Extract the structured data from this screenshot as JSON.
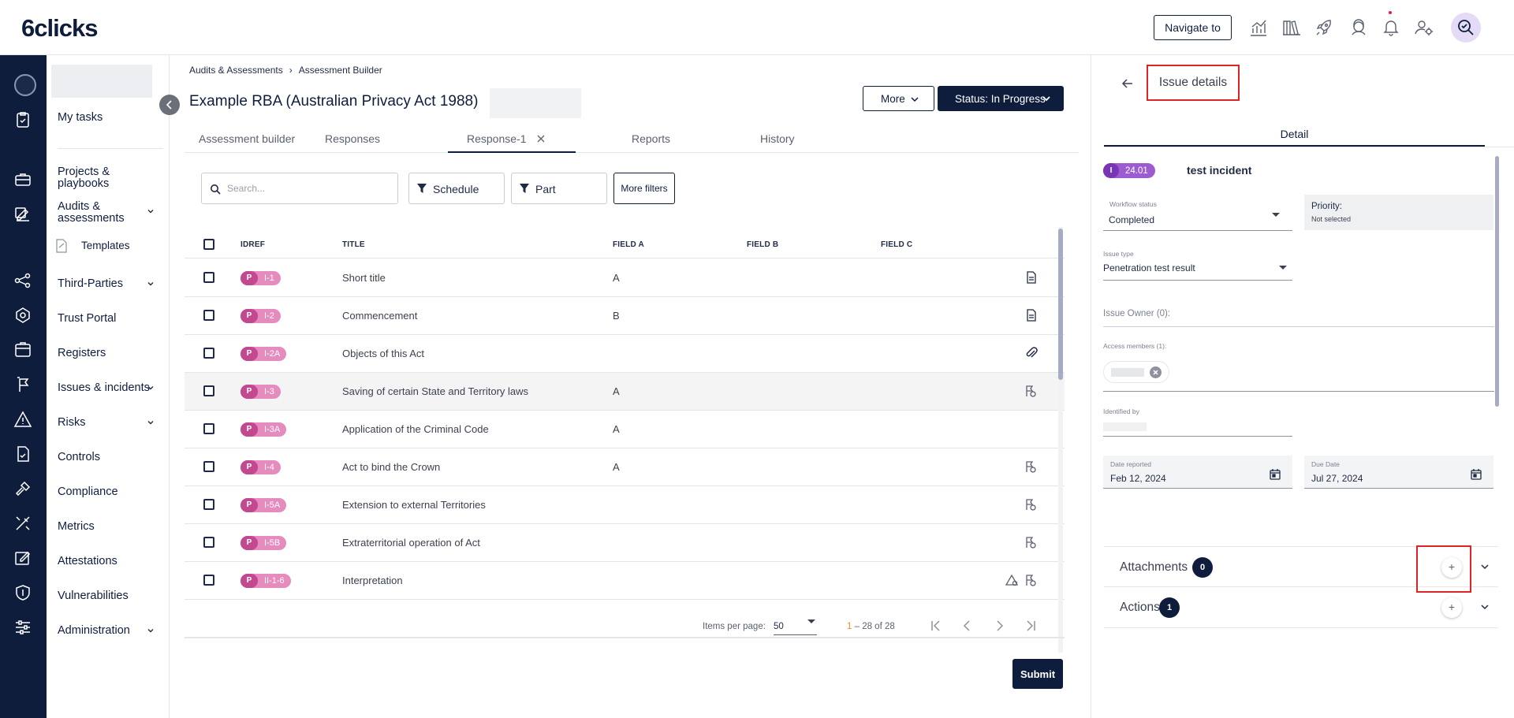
{
  "app": {
    "logo": "6clicks",
    "navigate_label": "Navigate to"
  },
  "sidebar": {
    "items": [
      {
        "label": "My tasks"
      },
      {
        "label": "Projects & playbooks"
      },
      {
        "label": "Audits & assessments"
      },
      {
        "label": "Templates"
      },
      {
        "label": "Third-Parties"
      },
      {
        "label": "Trust Portal"
      },
      {
        "label": "Registers"
      },
      {
        "label": "Issues & incidents"
      },
      {
        "label": "Risks"
      },
      {
        "label": "Controls"
      },
      {
        "label": "Compliance"
      },
      {
        "label": "Metrics"
      },
      {
        "label": "Attestations"
      },
      {
        "label": "Vulnerabilities"
      },
      {
        "label": "Administration"
      }
    ]
  },
  "breadcrumb": {
    "root": "Audits & Assessments",
    "current": "Assessment Builder"
  },
  "page": {
    "title": "Example RBA (Australian Privacy Act 1988)",
    "more_label": "More",
    "status_label": "Status: In Progress"
  },
  "tabs": [
    {
      "label": "Assessment builder"
    },
    {
      "label": "Responses"
    },
    {
      "label": "Response-1"
    },
    {
      "label": "Reports"
    },
    {
      "label": "History"
    }
  ],
  "filters": {
    "search_placeholder": "Search...",
    "schedule": "Schedule",
    "part": "Part",
    "more": "More filters"
  },
  "table": {
    "columns": [
      "IDREF",
      "TITLE",
      "FIELD A",
      "FIELD B",
      "FIELD C"
    ],
    "rows": [
      {
        "type": "P",
        "id": "I-1",
        "title": "Short title",
        "field_a": "A"
      },
      {
        "type": "P",
        "id": "I-2",
        "title": "Commencement",
        "field_a": "B"
      },
      {
        "type": "P",
        "id": "I-2A",
        "title": "Objects of this Act",
        "field_a": ""
      },
      {
        "type": "P",
        "id": "I-3",
        "title": "Saving of certain State and Territory laws",
        "field_a": "A"
      },
      {
        "type": "P",
        "id": "I-3A",
        "title": "Application of the Criminal Code",
        "field_a": "A"
      },
      {
        "type": "P",
        "id": "I-4",
        "title": "Act to bind the Crown",
        "field_a": "A"
      },
      {
        "type": "P",
        "id": "I-5A",
        "title": "Extension to external Territories",
        "field_a": ""
      },
      {
        "type": "P",
        "id": "I-5B",
        "title": "Extraterritorial operation of Act",
        "field_a": ""
      },
      {
        "type": "P",
        "id": "II-1-6",
        "title": "Interpretation",
        "field_a": ""
      }
    ]
  },
  "pagination": {
    "items_per_page_label": "Items per page:",
    "items_per_page": "50",
    "range_start": "1",
    "range_rest": " – 28 of 28"
  },
  "submit_label": "Submit",
  "issue": {
    "panel_title": "Issue details",
    "detail_tab": "Detail",
    "type_letter": "I",
    "number": "24.01",
    "name": "test incident",
    "workflow_label": "Workflow status",
    "workflow_value": "Completed",
    "priority_label": "Priority:",
    "priority_value": "Not selected",
    "issue_type_label": "Issue type",
    "issue_type_value": "Penetration test result",
    "owner_label": "Issue Owner (0):",
    "members_label": "Access members (1):",
    "identified_label": "Identified by",
    "date_reported_label": "Date reported",
    "date_reported": "Feb 12, 2024",
    "due_date_label": "Due Date",
    "due_date": "Jul 27, 2024",
    "attachments_label": "Attachments",
    "attachments_count": "0",
    "actions_label": "Actions",
    "actions_count": "1",
    "plus": "+"
  },
  "colors": {
    "navy": "#0f1d3d",
    "accent_red": "#e02424",
    "chip_pink": "#c2488f",
    "chip_purple": "#7a35b5"
  }
}
